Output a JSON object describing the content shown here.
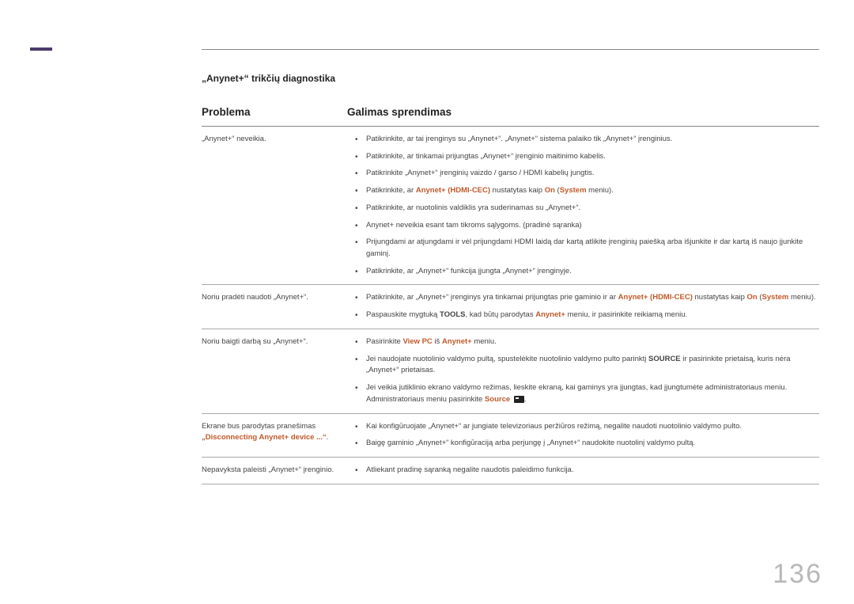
{
  "page_number": "136",
  "section_title": "„Anynet+“ trikčių diagnostika",
  "headers": {
    "problem": "Problema",
    "solution": "Galimas sprendimas"
  },
  "rows": [
    {
      "problem_html": "„Anynet+“ neveikia.",
      "items": [
        "Patikrinkite, ar tai įrenginys su „Anynet+“. „Anynet+“ sistema palaiko tik „Anynet+“ įrenginius.",
        "Patikrinkite, ar tinkamai prijungtas „Anynet+“ įrenginio maitinimo kabelis.",
        "Patikrinkite „Anynet+“ įrenginių vaizdo / garso / HDMI kabelių jungtis.",
        "Patikrinkite, ar <span class='hl bold'>Anynet+ (HDMI-CEC)</span> nustatytas kaip <span class='hl bold'>On</span> (<span class='hl bold'>System</span> meniu).",
        "Patikrinkite, ar nuotolinis valdiklis yra suderinamas su „Anynet+“.",
        "Anynet+ neveikia esant tam tikroms sąlygoms. (pradinė sąranka)",
        "Prijungdami ar atjungdami ir vėl prijungdami HDMI laidą dar kartą atlikite įrenginių paiešką arba išjunkite ir dar kartą iš naujo įjunkite gaminį.",
        "Patikrinkite, ar „Anynet+“ funkcija įjungta „Anynet+“ įrenginyje."
      ]
    },
    {
      "problem_html": "Noriu pradėti naudoti „Anynet+“.",
      "items": [
        "Patikrinkite, ar „Anynet+“ įrenginys yra tinkamai prijungtas prie gaminio ir ar <span class='hl bold'>Anynet+ (HDMI-CEC)</span> nustatytas kaip <span class='hl bold'>On</span> (<span class='hl bold'>System</span> meniu).",
        "Paspauskite mygtuką <span class='bold'>TOOLS</span>, kad būtų parodytas <span class='hl bold'>Anynet+</span> meniu, ir pasirinkite reikiamą meniu."
      ]
    },
    {
      "problem_html": "Noriu baigti darbą su „Anynet+“.",
      "items": [
        "Pasirinkite <span class='hl bold'>View PC</span> iš <span class='hl bold'>Anynet+</span> meniu.",
        "Jei naudojate nuotolinio valdymo pultą, spustelėkite nuotolinio valdymo pulto parinktį <span class='bold'>SOURCE</span> ir pasirinkite prietaisą, kuris nėra „Anynet+“ prietaisas.",
        "Jei veikia jutiklinio ekrano valdymo režimas, lieskite ekraną, kai gaminys yra įjungtas, kad įjungtumėte administratoriaus meniu. Administratoriaus meniu pasirinkite <span class='hl bold'>Source</span> <span class='icon-box' data-name='source-icon' data-interactable='false'></span>."
      ]
    },
    {
      "problem_html": "Ekrane bus parodytas pranešimas <span class='hl bold'>„Disconnecting Anynet+ device ...“</span>.",
      "items": [
        "Kai konfigūruojate „Anynet+“ ar jungiate televizoriaus peržiūros režimą, negalite naudoti nuotolinio valdymo pulto.",
        "Baigę gaminio „Anynet+“ konfigūraciją arba perjungę į „Anynet+“ naudokite nuotolinį valdymo pultą."
      ]
    },
    {
      "problem_html": "Nepavyksta paleisti „Anynet+“ įrenginio.",
      "items": [
        "Atliekant pradinę sąranką negalite naudotis paleidimo funkcija."
      ]
    }
  ]
}
